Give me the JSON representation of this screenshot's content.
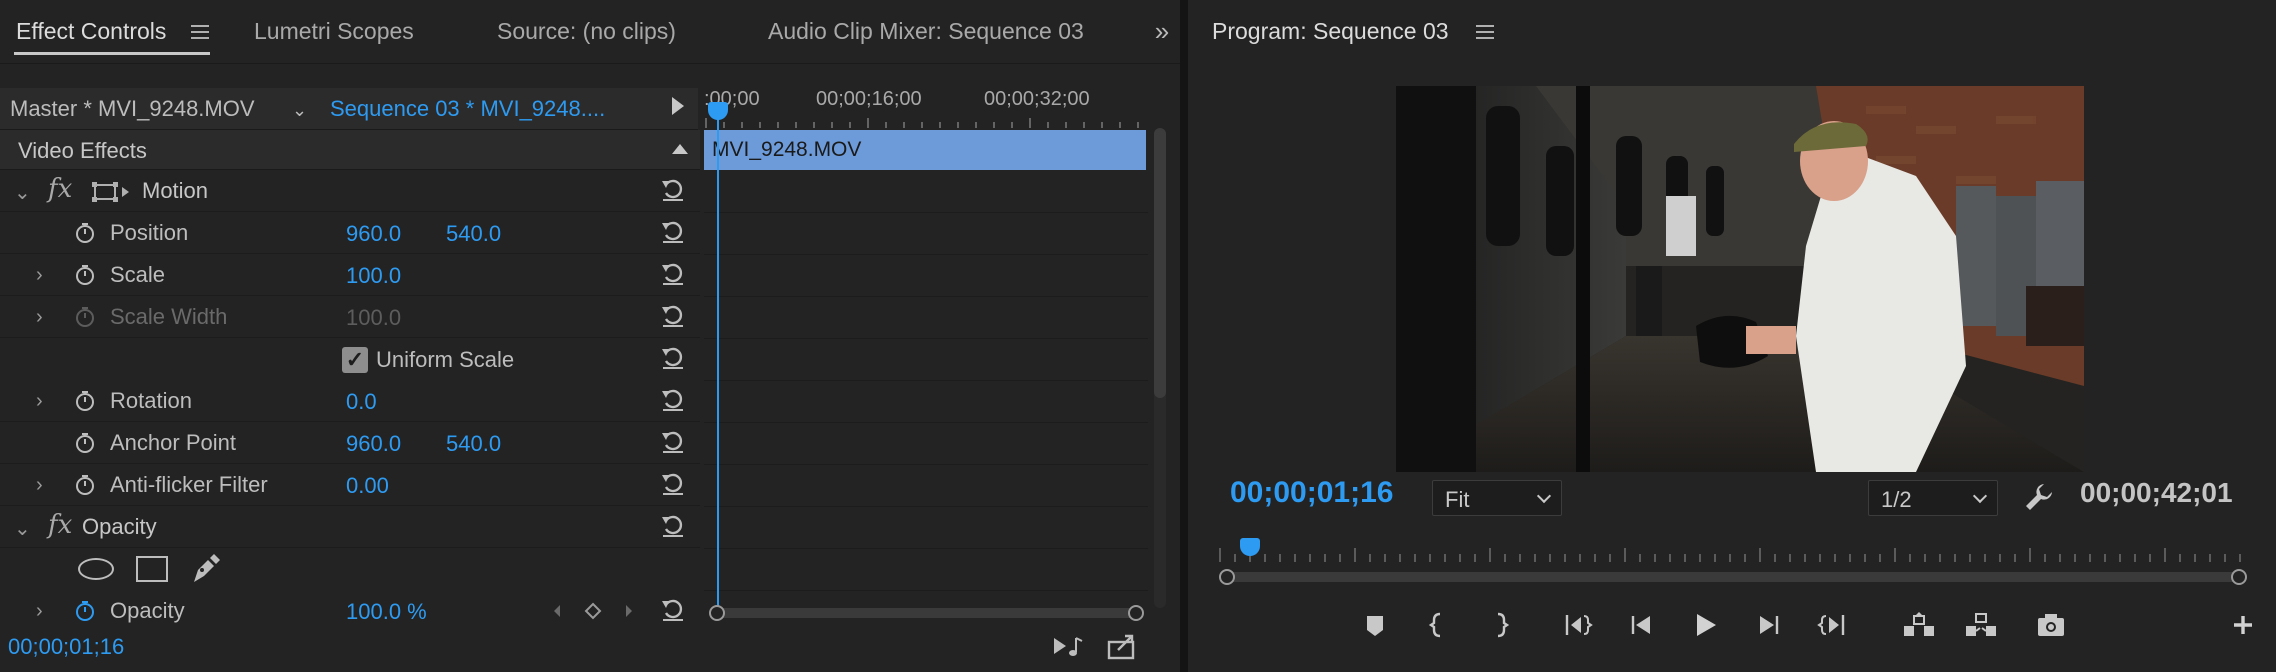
{
  "tabs": [
    {
      "label": "Effect Controls",
      "active": true
    },
    {
      "label": "Lumetri Scopes",
      "active": false
    },
    {
      "label": "Source: (no clips)",
      "active": false
    },
    {
      "label": "Audio Clip Mixer: Sequence 03",
      "active": false
    }
  ],
  "overflow_icon": "double-chevron-right-icon",
  "effect_controls": {
    "master_clip": "Master * MVI_9248.MOV",
    "sequence_clip": "Sequence 03 * MVI_9248....",
    "section_title": "Video Effects",
    "motion": {
      "name": "Motion",
      "position": {
        "label": "Position",
        "x": "960.0",
        "y": "540.0"
      },
      "scale": {
        "label": "Scale",
        "value": "100.0"
      },
      "scale_width": {
        "label": "Scale Width",
        "value": "100.0"
      },
      "uniform_scale": {
        "label": "Uniform Scale",
        "checked": true
      },
      "rotation": {
        "label": "Rotation",
        "value": "0.0"
      },
      "anchor_point": {
        "label": "Anchor Point",
        "x": "960.0",
        "y": "540.0"
      },
      "anti_flicker": {
        "label": "Anti-flicker Filter",
        "value": "0.00"
      }
    },
    "opacity": {
      "name": "Opacity",
      "property": {
        "label": "Opacity",
        "value": "100.0 %"
      }
    },
    "timecode": "00;00;01;16"
  },
  "mini_timeline": {
    "ruler": [
      ":00;00",
      "00;00;16;00",
      "00;00;32;00"
    ],
    "clip_name": "MVI_9248.MOV"
  },
  "program_monitor": {
    "title": "Program: Sequence 03",
    "playhead_timecode": "00;00;01;16",
    "zoom": "Fit",
    "resolution": "1/2",
    "duration_timecode": "00;00;42;01",
    "transport_icons": [
      "add-marker-icon",
      "mark-in-icon",
      "mark-out-icon",
      "go-to-in-icon",
      "step-back-icon",
      "play-icon",
      "step-forward-icon",
      "go-to-out-icon",
      "lift-icon",
      "extract-icon",
      "export-frame-icon",
      "button-editor-icon"
    ]
  },
  "colors": {
    "accent_blue": "#2e9bf2",
    "clip_blue": "#6d9bd9",
    "panel_bg": "#232323"
  }
}
